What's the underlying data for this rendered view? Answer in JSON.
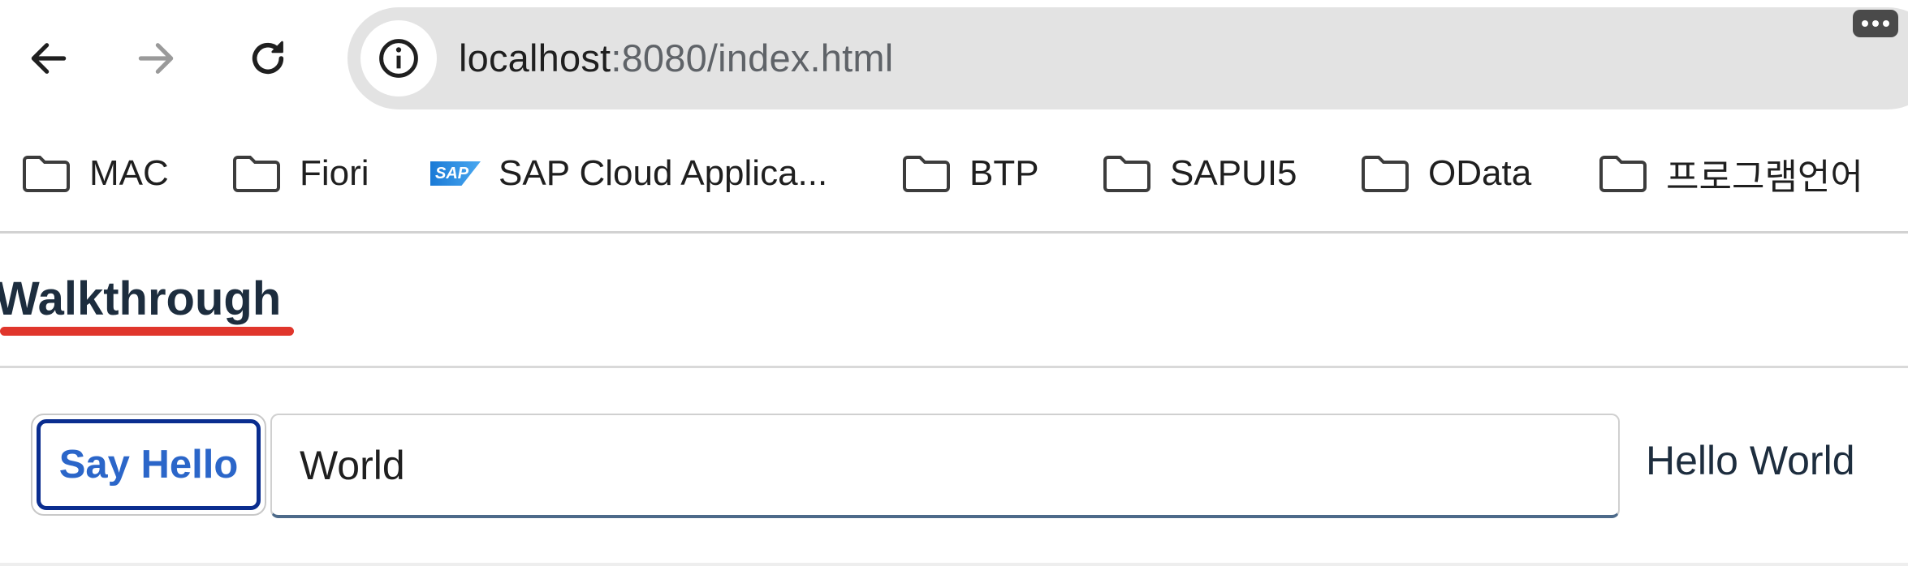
{
  "browser": {
    "url_host": "localhost",
    "url_rest": ":8080/index.html",
    "icons": {
      "back": "arrow-left-icon",
      "forward": "arrow-right-icon",
      "reload": "reload-icon",
      "info": "info-icon",
      "more": "more-dots-icon"
    }
  },
  "bookmarks": [
    {
      "label": "MAC",
      "icon": "folder-icon"
    },
    {
      "label": "Fiori",
      "icon": "folder-icon"
    },
    {
      "label": "SAP Cloud Applica...",
      "icon": "sap-logo-icon",
      "logo_text": "SAP"
    },
    {
      "label": "BTP",
      "icon": "folder-icon"
    },
    {
      "label": "SAPUI5",
      "icon": "folder-icon"
    },
    {
      "label": "OData",
      "icon": "folder-icon"
    },
    {
      "label": "프로그램언어",
      "icon": "folder-icon"
    }
  ],
  "app": {
    "title": "Walkthrough",
    "accent_color": "#e0362c",
    "button_label": "Say Hello",
    "input_value": "World",
    "greeting_text": "Hello World",
    "button_text_color": "#2b66c9",
    "button_focus_color": "#0a2d8f"
  }
}
